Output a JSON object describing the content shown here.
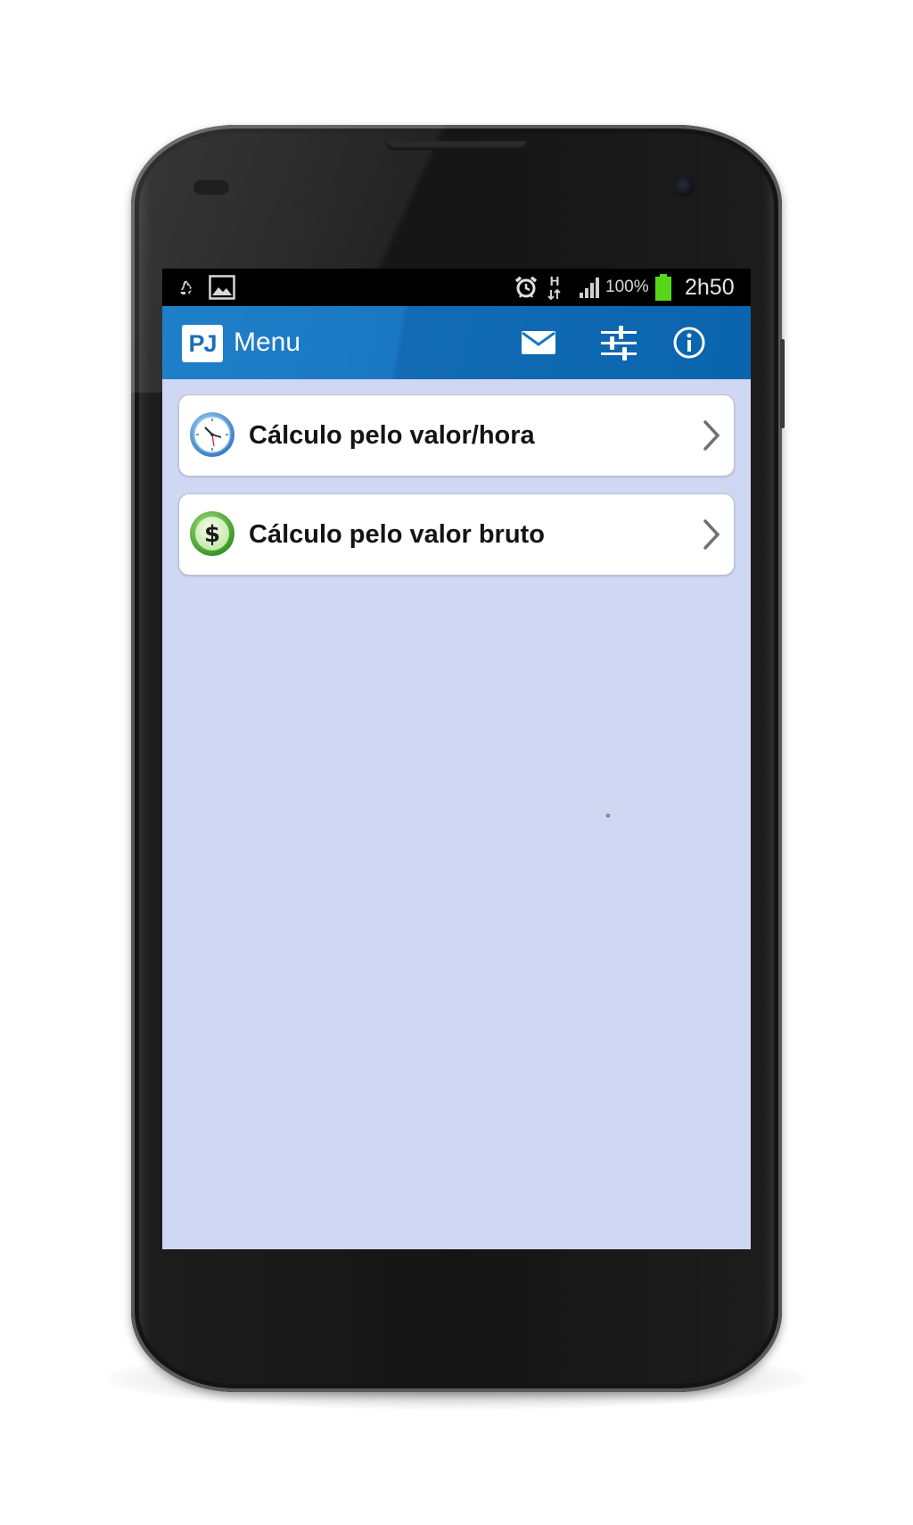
{
  "status_bar": {
    "left_icons": [
      "recycle-icon",
      "image-icon"
    ],
    "right_icons": [
      "alarm-icon",
      "network-h-icon",
      "signal-icon",
      "battery-icon"
    ],
    "network_label": "H",
    "battery_percent": "100%",
    "time": "2h50"
  },
  "app_bar": {
    "logo_text": "PJ",
    "title": "Menu",
    "actions": [
      {
        "name": "mail",
        "icon": "mail-icon"
      },
      {
        "name": "settings",
        "icon": "sliders-icon"
      },
      {
        "name": "info",
        "icon": "info-icon"
      }
    ]
  },
  "menu": {
    "items": [
      {
        "label": "Cálculo pelo valor/hora",
        "icon": "clock-icon"
      },
      {
        "label": "Cálculo pelo valor bruto",
        "icon": "dollar-icon"
      }
    ]
  },
  "colors": {
    "app_bar": "#1a78c2",
    "screen_background": "#d0d7f2",
    "battery": "#58d618",
    "card_background": "#ffffff"
  }
}
